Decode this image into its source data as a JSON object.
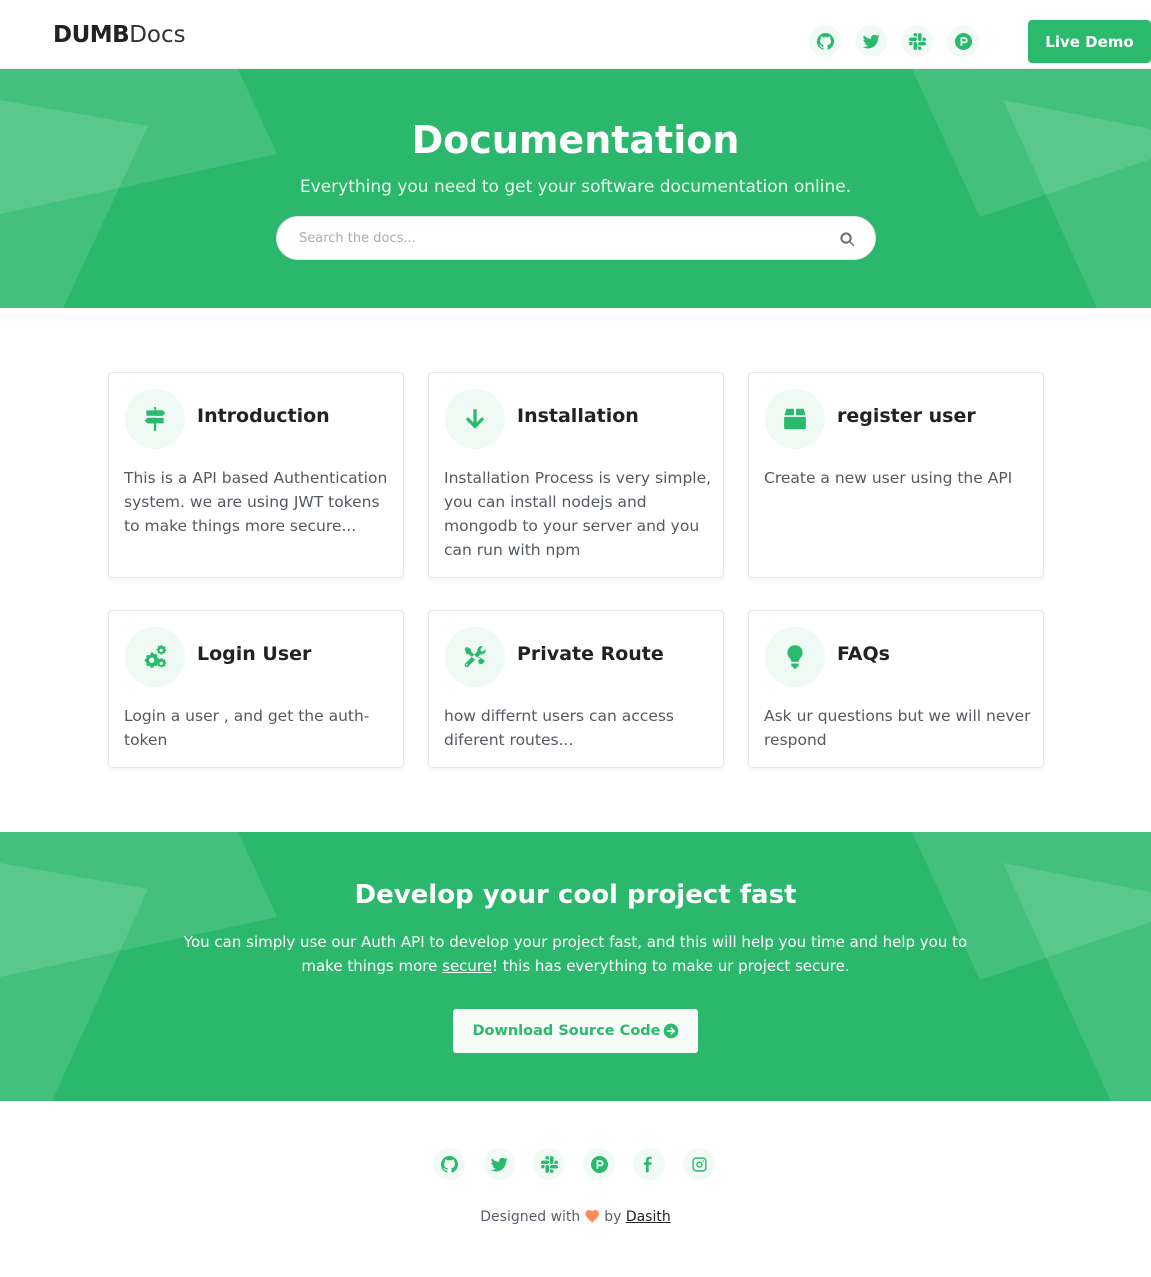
{
  "header": {
    "logo_bold": "DUMB",
    "logo_light": "Docs",
    "social": [
      "github-icon",
      "twitter-icon",
      "slack-icon",
      "product-hunt-icon"
    ],
    "live_demo_label": "Live Demo"
  },
  "hero": {
    "title": "Documentation",
    "subtitle": "Everything you need to get your software documentation online.",
    "search_placeholder": "Search the docs..."
  },
  "cards": [
    {
      "icon": "signpost-icon",
      "title": "Introduction",
      "desc": "This is a API based Authentication system. we are using JWT tokens to make things more secure..."
    },
    {
      "icon": "arrow-down-icon",
      "title": "Installation",
      "desc": "Installation Process is very simple, you can install nodejs and mongodb to your server and you can run with npm"
    },
    {
      "icon": "box-icon",
      "title": "register user",
      "desc": "Create a new user using the API"
    },
    {
      "icon": "cogs-icon",
      "title": "Login User",
      "desc": "Login a user , and get the auth-token"
    },
    {
      "icon": "tools-icon",
      "title": "Private Route",
      "desc": "how differnt users can access diferent routes..."
    },
    {
      "icon": "lightbulb-icon",
      "title": "FAQs",
      "desc": "Ask ur questions but we will never respond"
    }
  ],
  "cta": {
    "title": "Develop your cool project fast",
    "text_before": "You can simply use our Auth API to develop your project fast, and this will help you time and help you to make things more ",
    "link_text": "secure",
    "text_after": "! this has everything to make ur project secure.",
    "button_label": "Download Source Code"
  },
  "footer": {
    "social": [
      "github-icon",
      "twitter-icon",
      "slack-icon",
      "product-hunt-icon",
      "facebook-icon",
      "instagram-icon"
    ],
    "credit_prefix": "Designed with",
    "credit_by": "by",
    "credit_author": "Dasith"
  },
  "colors": {
    "brand_green": "#2bb96d",
    "icon_bg": "#eefaf3",
    "heart": "#f88c5b"
  }
}
